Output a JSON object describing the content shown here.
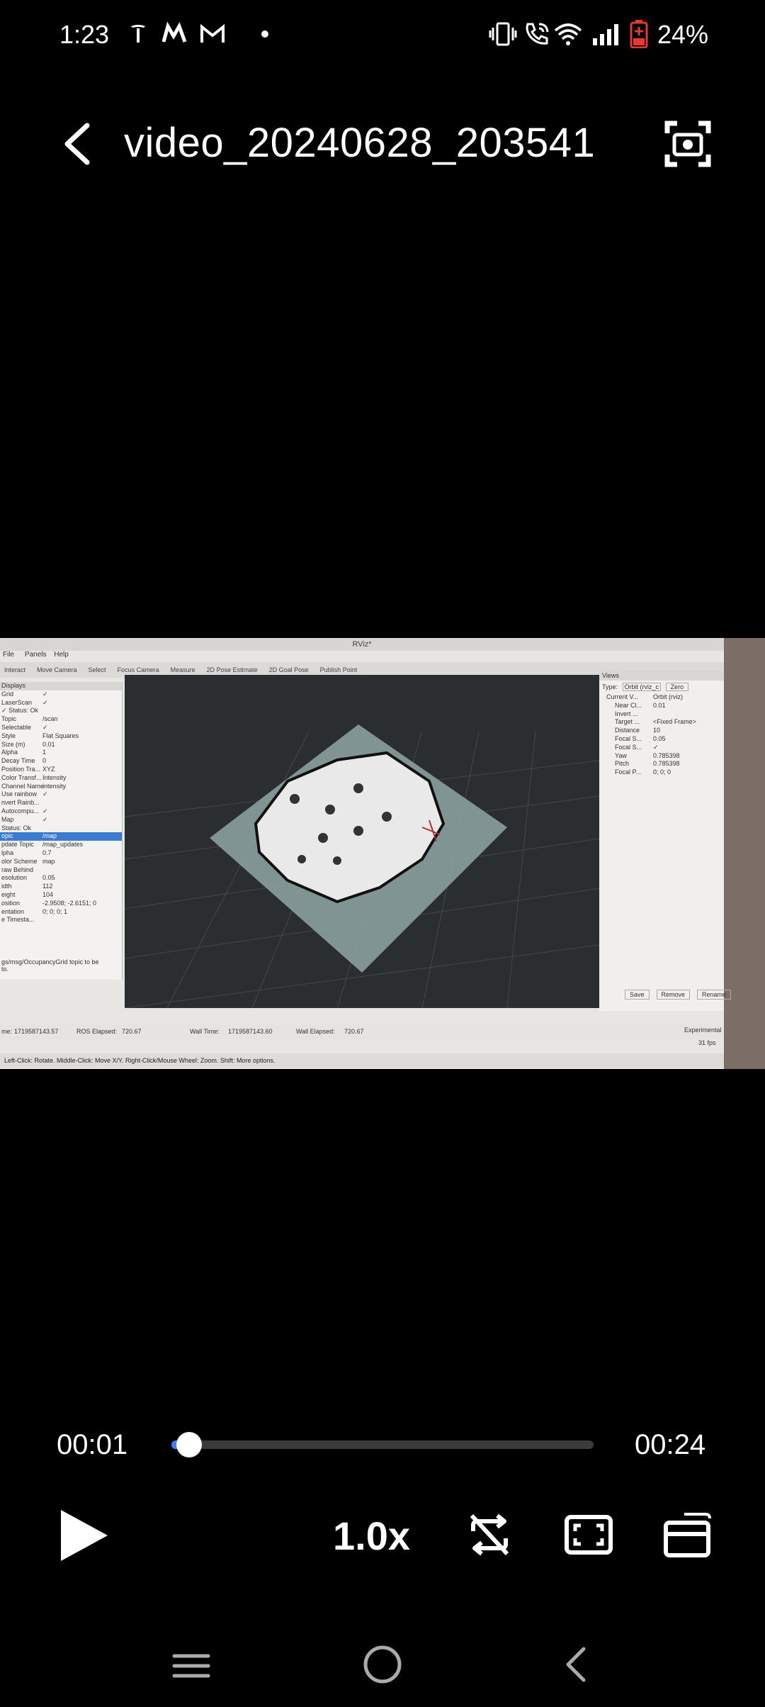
{
  "status_bar": {
    "time": "1:23",
    "battery_percent": "24%",
    "icons": [
      "tesla-icon",
      "myntra-icon",
      "gmail-icon",
      "dot-icon",
      "vibrate-icon",
      "wifi-calling-icon",
      "wifi-icon",
      "signal-icon",
      "battery-charging-icon"
    ]
  },
  "top_bar": {
    "title": "video_20240628_203541",
    "back_icon": "back-arrow-icon",
    "capture_icon": "screenshot-capture-icon"
  },
  "video_frame": {
    "window_title": "RViz*",
    "menu": [
      "File",
      "Panels",
      "Help"
    ],
    "toolbar": [
      "Interact",
      "Move Camera",
      "Select",
      "Focus Camera",
      "Measure",
      "2D Pose Estimate",
      "2D Goal Pose",
      "Publish Point"
    ],
    "displays_header": "Displays",
    "displays": [
      {
        "k": "Grid",
        "v": "✓"
      },
      {
        "k": "LaserScan",
        "v": "✓"
      },
      {
        "k": "✓ Status: Ok",
        "v": ""
      },
      {
        "k": "Topic",
        "v": "/scan"
      },
      {
        "k": "Selectable",
        "v": "✓"
      },
      {
        "k": "Style",
        "v": "Flat Squares"
      },
      {
        "k": "Size (m)",
        "v": "0.01"
      },
      {
        "k": "Alpha",
        "v": "1"
      },
      {
        "k": "Decay Time",
        "v": "0"
      },
      {
        "k": "Position Tra...",
        "v": "XYZ"
      },
      {
        "k": "Color Transf...",
        "v": "Intensity"
      },
      {
        "k": "Channel Name",
        "v": "intensity"
      },
      {
        "k": "Use rainbow",
        "v": "✓"
      },
      {
        "k": "nvert Rainb...",
        "v": ""
      },
      {
        "k": "Autocompu...",
        "v": "✓"
      },
      {
        "k": "Map",
        "v": "✓"
      },
      {
        "k": "Status: Ok",
        "v": ""
      },
      {
        "k": "opic",
        "v": "/map",
        "selected": true
      },
      {
        "k": "pdate Topic",
        "v": "/map_updates"
      },
      {
        "k": "lpha",
        "v": "0.7"
      },
      {
        "k": "olor Scheme",
        "v": "map"
      },
      {
        "k": "raw Behind",
        "v": ""
      },
      {
        "k": "esolution",
        "v": "0.05"
      },
      {
        "k": "idth",
        "v": "112"
      },
      {
        "k": "eight",
        "v": "104"
      },
      {
        "k": "osition",
        "v": "-2.9508; -2.6151; 0"
      },
      {
        "k": "entation",
        "v": "0; 0; 0; 1"
      },
      {
        "k": "e Timesta...",
        "v": ""
      }
    ],
    "displays_footer": "gs/msg/OccupancyGrid topic to be to.",
    "views_header": "Views",
    "views_type_label": "Type:",
    "views_type_value": "Orbit (rviz_c",
    "views_zero": "Zero",
    "views_rows": [
      {
        "k": "Current V...",
        "v": "Orbit (rviz)"
      },
      {
        "k": "Near Cl...",
        "v": "0.01"
      },
      {
        "k": "Invert ...",
        "v": ""
      },
      {
        "k": "Target ...",
        "v": "<Fixed Frame>"
      },
      {
        "k": "Distance",
        "v": "10"
      },
      {
        "k": "Focal S...",
        "v": "0.05"
      },
      {
        "k": "Focal S...",
        "v": "✓"
      },
      {
        "k": "Yaw",
        "v": "0.785398"
      },
      {
        "k": "Pitch",
        "v": "0.785398"
      },
      {
        "k": "Focal P...",
        "v": "0; 0; 0"
      }
    ],
    "views_buttons": [
      "Save",
      "Remove",
      "Rename"
    ],
    "status_row": {
      "ros_time_label": "me:",
      "ros_time": "1719587143.57",
      "ros_elapsed_label": "ROS Elapsed:",
      "ros_elapsed": "720.67",
      "wall_time_label": "Wall Time:",
      "wall_time": "1719587143.60",
      "wall_elapsed_label": "Wall Elapsed:",
      "wall_elapsed": "720.67",
      "experimental": "Experimental",
      "fps": "31 fps"
    },
    "hint": "Left-Click: Rotate. Middle-Click: Move X/Y. Right-Click/Mouse Wheel: Zoom. Shift: More options."
  },
  "playback": {
    "current_time": "00:01",
    "total_time": "00:24",
    "progress_fraction": 0.042,
    "speed": "1.0x"
  },
  "nav_bar": {
    "icons": [
      "recents-icon",
      "home-icon",
      "back-icon"
    ]
  }
}
